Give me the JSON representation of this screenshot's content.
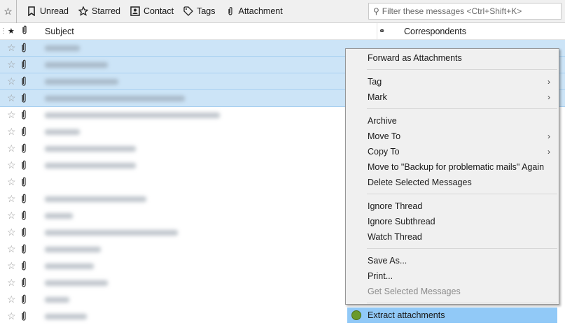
{
  "toolbar": {
    "unread": "Unread",
    "starred": "Starred",
    "contact": "Contact",
    "tags": "Tags",
    "attachment": "Attachment"
  },
  "search": {
    "placeholder": "Filter these messages <Ctrl+Shift+K>"
  },
  "columns": {
    "subject": "Subject",
    "correspondents": "Correspondents"
  },
  "rows": [
    {
      "selected": true
    },
    {
      "selected": true
    },
    {
      "selected": true
    },
    {
      "selected": true
    },
    {},
    {},
    {},
    {},
    {},
    {},
    {},
    {},
    {},
    {},
    {},
    {},
    {}
  ],
  "menu": {
    "forward": "Forward as Attachments",
    "tag": "Tag",
    "mark": "Mark",
    "archive": "Archive",
    "move_to": "Move To",
    "copy_to": "Copy To",
    "move_again": "Move to \"Backup for problematic mails\" Again",
    "delete": "Delete Selected Messages",
    "ignore_thread": "Ignore Thread",
    "ignore_subthread": "Ignore Subthread",
    "watch_thread": "Watch Thread",
    "save_as": "Save As...",
    "print": "Print...",
    "get_selected": "Get Selected Messages",
    "extract": "Extract attachments"
  }
}
